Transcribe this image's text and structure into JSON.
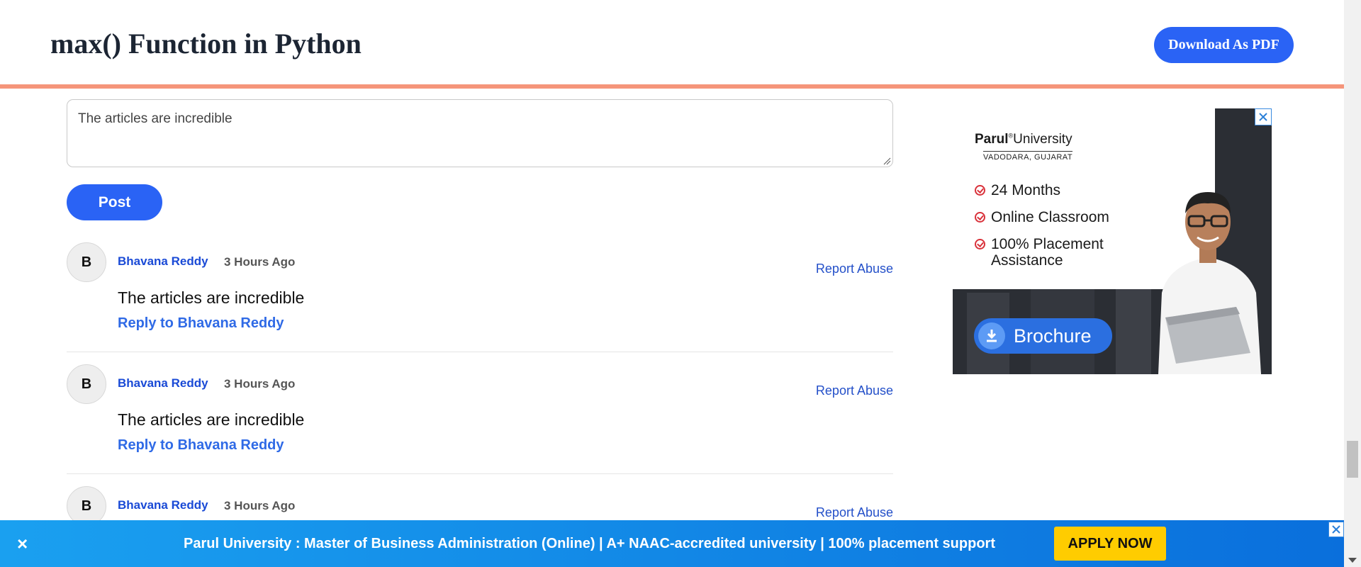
{
  "header": {
    "title": "max() Function in Python",
    "download_label": "Download As PDF"
  },
  "comment_form": {
    "input_value": "The articles are incredible",
    "post_label": "Post"
  },
  "comments": [
    {
      "initial": "B",
      "author": "Bhavana Reddy",
      "time": "3 Hours Ago",
      "report": "Report Abuse",
      "text": "The articles are incredible",
      "reply": "Reply to Bhavana Reddy"
    },
    {
      "initial": "B",
      "author": "Bhavana Reddy",
      "time": "3 Hours Ago",
      "report": "Report Abuse",
      "text": "The articles are incredible",
      "reply": "Reply to Bhavana Reddy"
    },
    {
      "initial": "B",
      "author": "Bhavana Reddy",
      "time": "3 Hours Ago",
      "report": "Report Abuse"
    }
  ],
  "ad": {
    "brand": "Parul",
    "brand_suffix": "University",
    "location": "VADODARA, GUJARAT",
    "features": [
      "24 Months",
      "Online Classroom",
      "100% Placement Assistance"
    ],
    "cta": "Brochure"
  },
  "banner": {
    "close_symbol": "×",
    "text": "Parul University : Master of Business Administration (Online) | A+ NAAC-accredited university | 100% placement support",
    "cta": "APPLY NOW"
  },
  "colors": {
    "accent": "#2a63f5",
    "header_rule": "#f5957a",
    "link": "#1a4ad6",
    "banner": "#1aa0f0",
    "apply": "#ffcc00"
  }
}
